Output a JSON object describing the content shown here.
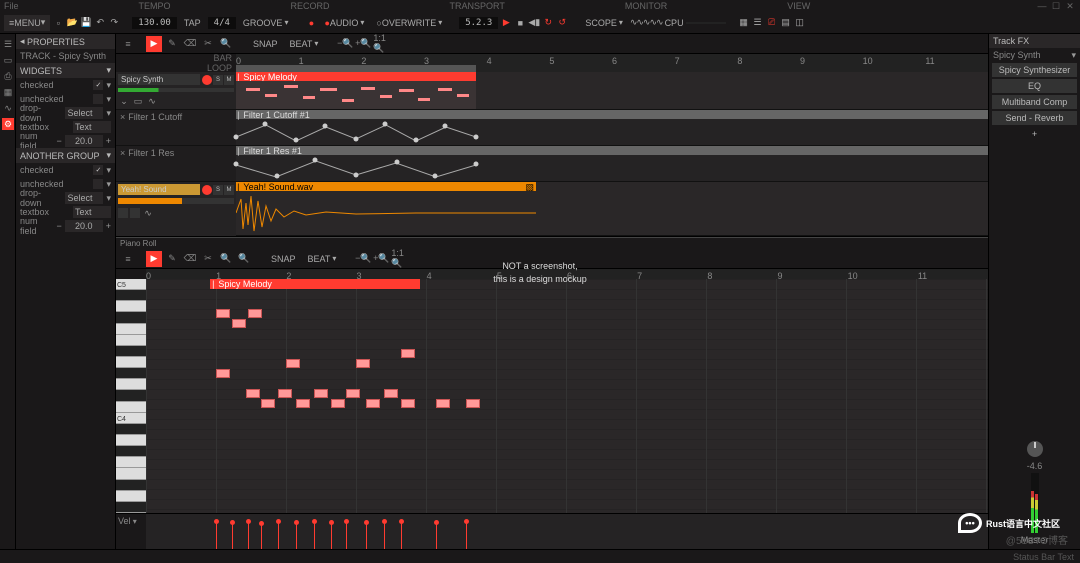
{
  "menubar": {
    "sections": [
      "File",
      "TEMPO",
      "RECORD",
      "TRANSPORT",
      "MONITOR",
      "VIEW"
    ],
    "window_controls": [
      "min",
      "max",
      "close"
    ]
  },
  "toolbar": {
    "menu_label": "MENU",
    "tempo": "130.00",
    "tap": "TAP",
    "sig": "4/4",
    "groove": "GROOVE",
    "rec_mode": "AUDIO",
    "rec_behavior": "OVERWRITE",
    "transport_pos": "5.2.3",
    "scope": "SCOPE",
    "cpu": "CPU"
  },
  "properties": {
    "header": "PROPERTIES",
    "track_label": "TRACK - Spicy Synth",
    "groups": [
      {
        "name": "WIDGETS",
        "rows": [
          {
            "label": "checked",
            "type": "check",
            "value": true
          },
          {
            "label": "unchecked",
            "type": "check",
            "value": false
          },
          {
            "label": "drop-down",
            "type": "select",
            "value": "Select"
          },
          {
            "label": "textbox",
            "type": "text",
            "value": "Text"
          },
          {
            "label": "num field",
            "type": "num",
            "value": "20.0"
          }
        ]
      },
      {
        "name": "ANOTHER GROUP",
        "rows": [
          {
            "label": "checked",
            "type": "check",
            "value": true
          },
          {
            "label": "unchecked",
            "type": "check",
            "value": false
          },
          {
            "label": "drop-down",
            "type": "select",
            "value": "Select"
          },
          {
            "label": "textbox",
            "type": "text",
            "value": "Text"
          },
          {
            "label": "num field",
            "type": "num",
            "value": "20.0"
          }
        ]
      }
    ]
  },
  "workstrip": {
    "snap": "SNAP",
    "grid": "BEAT"
  },
  "ruler": {
    "bar_label": "BAR",
    "loop_label": "LOOP",
    "numbers": [
      "0",
      "1",
      "2",
      "3",
      "4",
      "5",
      "6",
      "7",
      "8",
      "9",
      "10",
      "11"
    ]
  },
  "tracks": [
    {
      "name": "Spicy Synth",
      "type": "midi",
      "clip_name": "Spicy Melody",
      "lanes": [
        {
          "name": "Filter 1 Cutoff",
          "header": "Filter 1 Cutoff #1"
        },
        {
          "name": "Filter 1 Res",
          "header": "Filter 1 Res #1"
        }
      ]
    },
    {
      "name": "Yeah! Sound",
      "type": "audio",
      "clip_name": "Yeah! Sound.wav"
    }
  ],
  "piano_roll": {
    "title": "Piano Roll",
    "snap": "SNAP",
    "grid": "BEAT",
    "clip_name": "Spicy Melody",
    "key_labels": {
      "top": "C5",
      "mid": "C4"
    },
    "velocity_label": "Vel",
    "numbers": [
      "0",
      "1",
      "2",
      "3",
      "4",
      "5",
      "6",
      "7",
      "8",
      "9",
      "10",
      "11"
    ]
  },
  "track_fx": {
    "header": "Track FX",
    "track_name": "Spicy Synth",
    "items": [
      "Spicy Synthesizer",
      "EQ",
      "Multiband Comp",
      "Send - Reverb"
    ],
    "add": "+"
  },
  "master": {
    "label": "Master",
    "db": "-4.6"
  },
  "status": "Status Bar Text",
  "overlay": {
    "line1": "NOT a screenshot,",
    "line2": "this is a design mockup"
  },
  "watermark": "Rust语言中文社区",
  "faint": "@51CTO博客"
}
